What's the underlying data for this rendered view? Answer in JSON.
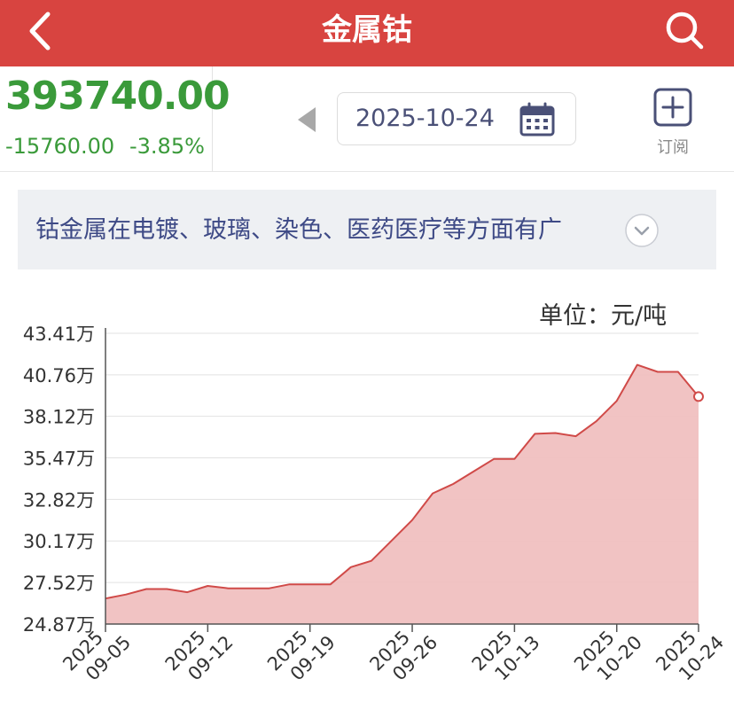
{
  "header": {
    "title": "金属钴"
  },
  "price": {
    "value": "393740.00",
    "change": "-15760.00",
    "change_pct": "-3.85%",
    "color": "#3a9a3a"
  },
  "date_picker": {
    "date": "2025-10-24"
  },
  "subscribe": {
    "label": "订阅"
  },
  "description": {
    "text": "钴金属在电镀、玻璃、染色、医药医疗等方面有广"
  },
  "chart_data": {
    "type": "area",
    "unit_label": "单位：元/吨",
    "y_ticks": [
      "43.41万",
      "40.76万",
      "38.12万",
      "35.47万",
      "32.82万",
      "30.17万",
      "27.52万",
      "24.87万"
    ],
    "y_tick_values": [
      434100,
      407600,
      381200,
      354700,
      328200,
      301700,
      275200,
      248700
    ],
    "ylim": [
      248700,
      434100
    ],
    "x_tick_labels": [
      {
        "date": "2025-09-05",
        "year": "2025",
        "md": "09-05"
      },
      {
        "date": "2025-09-12",
        "year": "2025",
        "md": "09-12"
      },
      {
        "date": "2025-09-19",
        "year": "2025",
        "md": "09-19"
      },
      {
        "date": "2025-09-26",
        "year": "2025",
        "md": "09-26"
      },
      {
        "date": "2025-10-13",
        "year": "2025",
        "md": "10-13"
      },
      {
        "date": "2025-10-20",
        "year": "2025",
        "md": "10-20"
      },
      {
        "date": "2025-10-24",
        "year": "2025",
        "md": "10-24"
      }
    ],
    "points": [
      {
        "date": "2025-09-05",
        "value": 265000
      },
      {
        "date": "2025-09-08",
        "value": 267500
      },
      {
        "date": "2025-09-09",
        "value": 271000
      },
      {
        "date": "2025-09-10",
        "value": 271000
      },
      {
        "date": "2025-09-11",
        "value": 269000
      },
      {
        "date": "2025-09-12",
        "value": 273000
      },
      {
        "date": "2025-09-15",
        "value": 271500
      },
      {
        "date": "2025-09-16",
        "value": 271500
      },
      {
        "date": "2025-09-17",
        "value": 271500
      },
      {
        "date": "2025-09-18",
        "value": 274000
      },
      {
        "date": "2025-09-19",
        "value": 274000
      },
      {
        "date": "2025-09-22",
        "value": 274000
      },
      {
        "date": "2025-09-23",
        "value": 285000
      },
      {
        "date": "2025-09-24",
        "value": 289000
      },
      {
        "date": "2025-09-25",
        "value": 302000
      },
      {
        "date": "2025-09-26",
        "value": 315000
      },
      {
        "date": "2025-09-29",
        "value": 332000
      },
      {
        "date": "2025-09-30",
        "value": 338000
      },
      {
        "date": "2025-10-09",
        "value": 346000
      },
      {
        "date": "2025-10-10",
        "value": 354000
      },
      {
        "date": "2025-10-13",
        "value": 354000
      },
      {
        "date": "2025-10-14",
        "value": 370000
      },
      {
        "date": "2025-10-15",
        "value": 370500
      },
      {
        "date": "2025-10-16",
        "value": 368500
      },
      {
        "date": "2025-10-17",
        "value": 378000
      },
      {
        "date": "2025-10-20",
        "value": 391000
      },
      {
        "date": "2025-10-21",
        "value": 414000
      },
      {
        "date": "2025-10-22",
        "value": 409500
      },
      {
        "date": "2025-10-23",
        "value": 409500
      },
      {
        "date": "2025-10-24",
        "value": 393740
      }
    ],
    "line_color": "#d04a48",
    "fill_color": "#f0c0c0",
    "grid": true
  }
}
